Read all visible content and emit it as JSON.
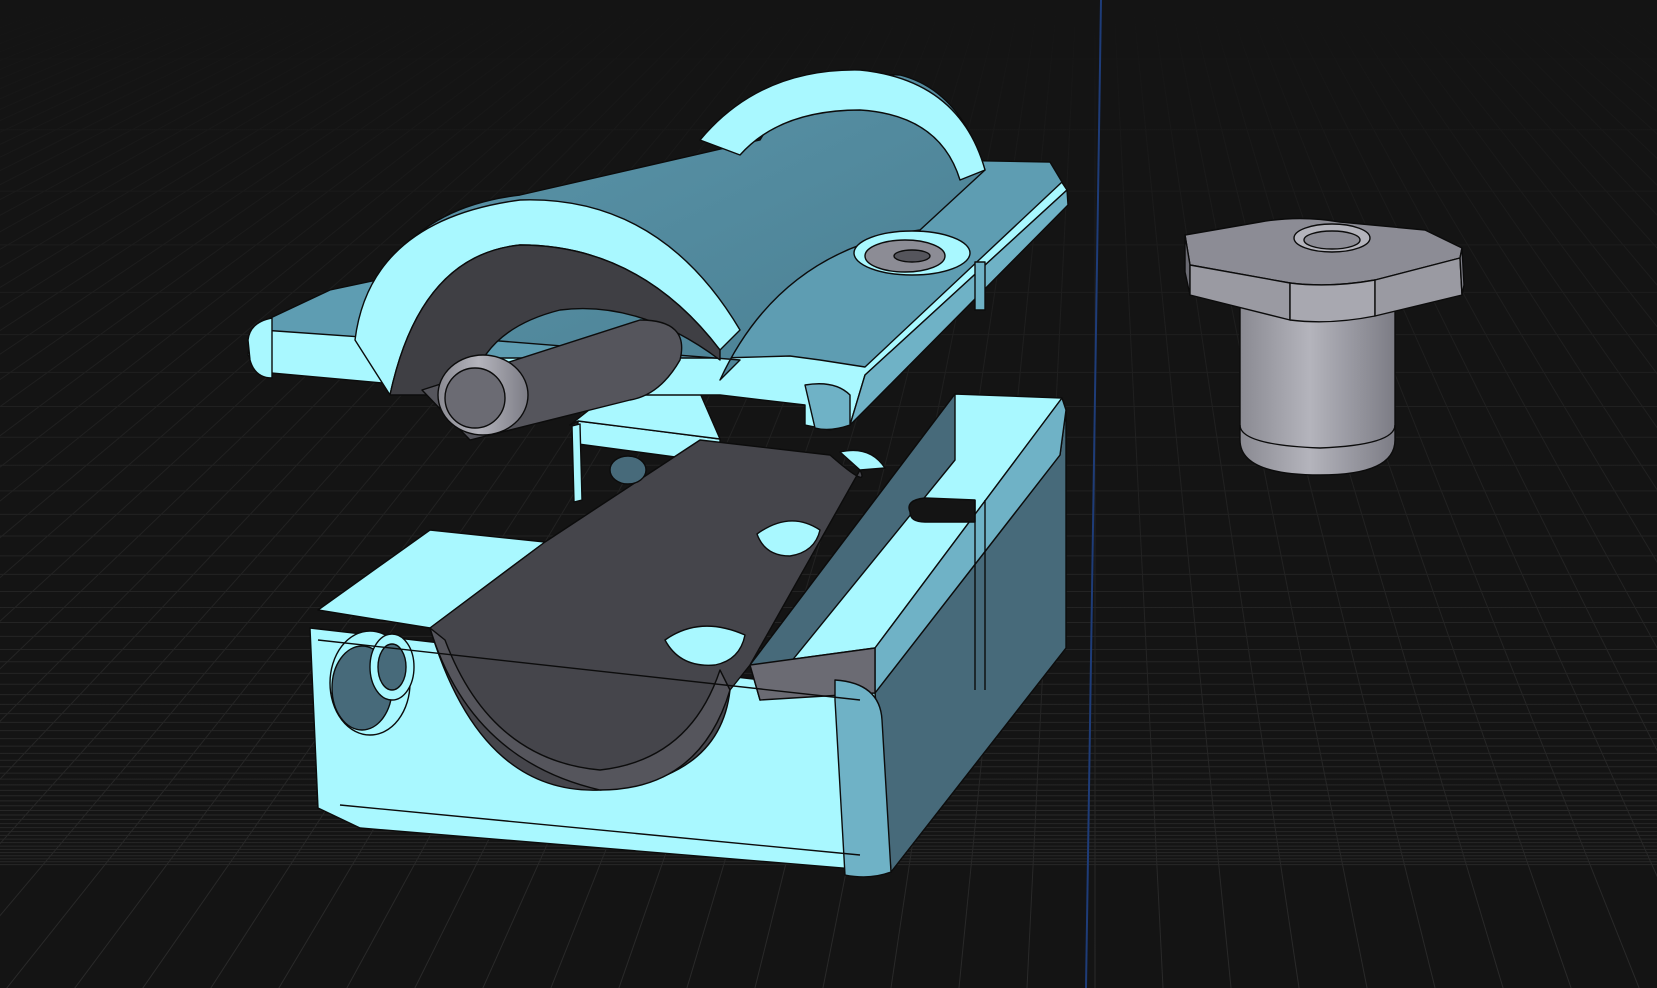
{
  "viewport": {
    "background": "#141414",
    "grid_color": "#2a2a2a",
    "axis_color": "#1f3f7a"
  },
  "colors": {
    "selected_light": "#a9f8ff",
    "selected_mid": "#6fb2c6",
    "selected_dark": "#476a7a",
    "cavity_dark": "#3f3f44",
    "cavity_mid": "#55555c",
    "part_gray_light": "#a8a8b0",
    "part_gray_mid": "#8c8c95",
    "part_gray_dark": "#6b6b73",
    "edge": "#0c0c0c"
  },
  "parts": [
    {
      "name": "upper-clamp",
      "selected": true
    },
    {
      "name": "lower-block",
      "selected": true
    },
    {
      "name": "knob-bolt",
      "selected": false
    }
  ]
}
